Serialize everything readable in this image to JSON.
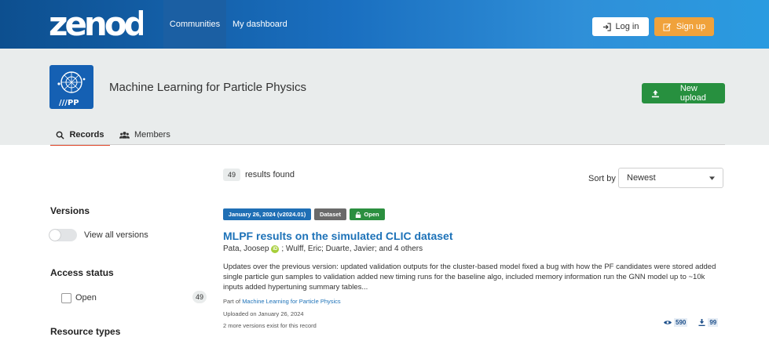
{
  "header": {
    "logo_text": "zenodo",
    "nav": [
      {
        "label": "Communities"
      },
      {
        "label": "My dashboard"
      }
    ],
    "login_label": "Log in",
    "signup_label": "Sign up"
  },
  "community": {
    "logo_text": "///PP",
    "title": "Machine Learning for Particle Physics",
    "new_upload_label": "New upload",
    "tabs": [
      {
        "label": "Records"
      },
      {
        "label": "Members"
      }
    ]
  },
  "search": {
    "count": "49",
    "results_label": "results found",
    "sort_label": "Sort by",
    "sort_value": "Newest"
  },
  "facets": {
    "versions": {
      "title": "Versions",
      "toggle_label": "View all versions"
    },
    "access": {
      "title": "Access status",
      "options": [
        {
          "label": "Open",
          "count": "49"
        }
      ]
    },
    "resource_types": {
      "title": "Resource types"
    }
  },
  "record": {
    "date_label": "January 26, 2024 (v2024.01)",
    "type_label": "Dataset",
    "access_label": "Open",
    "title": "MLPF results on the simulated CLIC dataset",
    "authors": {
      "first": "Pata, Joosep",
      "rest": "; Wulff, Eric;  Duarte, Javier;  and 4 others"
    },
    "description": "Updates over the previous version: updated validation outputs for the cluster-based model fixed a bug with how the PF candidates were stored added single particle gun samples to validation added new timing runs for the baseline algo, included memory information run the GNN model up to ~10k inputs added hypertuning summary tables...",
    "part_of_prefix": "Part of",
    "part_of_link": "Machine Learning for Particle Physics",
    "uploaded": "Uploaded on January 26, 2024",
    "versions_note": "2 more versions exist for this record",
    "views": "590",
    "downloads": "99"
  },
  "colors": {
    "primary_blue": "#1d72b8",
    "success_green": "#27903f",
    "signup_orange": "#f0a23b",
    "header_gray": "#e9ecec"
  }
}
